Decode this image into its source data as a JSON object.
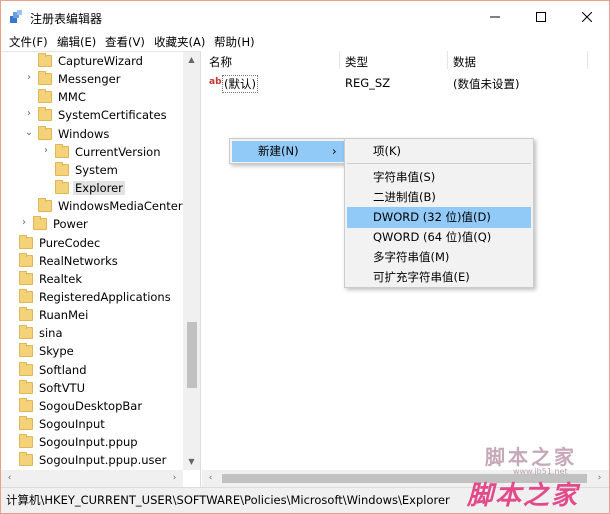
{
  "window": {
    "title": "注册表编辑器"
  },
  "menu": [
    "文件(F)",
    "编辑(E)",
    "查看(V)",
    "收藏夹(A)",
    "帮助(H)"
  ],
  "tree": {
    "items": [
      {
        "label": "CaptureWizard",
        "depth": 2,
        "chevron": ""
      },
      {
        "label": "Messenger",
        "depth": 2,
        "chevron": "›"
      },
      {
        "label": "MMC",
        "depth": 2,
        "chevron": ""
      },
      {
        "label": "SystemCertificates",
        "depth": 2,
        "chevron": "›"
      },
      {
        "label": "Windows",
        "depth": 2,
        "chevron": "⌄"
      },
      {
        "label": "CurrentVersion",
        "depth": 3,
        "chevron": "›"
      },
      {
        "label": "System",
        "depth": 3,
        "chevron": ""
      },
      {
        "label": "Explorer",
        "depth": 3,
        "chevron": "",
        "selected": true
      },
      {
        "label": "WindowsMediaCenter",
        "depth": 2,
        "chevron": ""
      },
      {
        "label": "Power",
        "depth": 1,
        "chevron": "›"
      },
      {
        "label": "PureCodec",
        "depth": 0,
        "chevron": ""
      },
      {
        "label": "RealNetworks",
        "depth": 0,
        "chevron": ""
      },
      {
        "label": "Realtek",
        "depth": 0,
        "chevron": ""
      },
      {
        "label": "RegisteredApplications",
        "depth": 0,
        "chevron": ""
      },
      {
        "label": "RuanMei",
        "depth": 0,
        "chevron": ""
      },
      {
        "label": "sina",
        "depth": 0,
        "chevron": ""
      },
      {
        "label": "Skype",
        "depth": 0,
        "chevron": ""
      },
      {
        "label": "Softland",
        "depth": 0,
        "chevron": ""
      },
      {
        "label": "SoftVTU",
        "depth": 0,
        "chevron": ""
      },
      {
        "label": "SogouDesktopBar",
        "depth": 0,
        "chevron": ""
      },
      {
        "label": "SogouInput",
        "depth": 0,
        "chevron": ""
      },
      {
        "label": "SogouInput.ppup",
        "depth": 0,
        "chevron": ""
      },
      {
        "label": "SogouInput.ppup.user",
        "depth": 0,
        "chevron": ""
      }
    ]
  },
  "list": {
    "columns": [
      "名称",
      "类型",
      "数据"
    ],
    "rows": [
      {
        "name": "(默认)",
        "type": "REG_SZ",
        "data": "(数值未设置)"
      }
    ]
  },
  "context_menu": {
    "parent_item": "新建(N)",
    "parent_arrow": "›",
    "submenu": [
      {
        "label": "项(K)"
      },
      {
        "label": "字符串值(S)"
      },
      {
        "label": "二进制值(B)"
      },
      {
        "label": "DWORD (32 位)值(D)",
        "highlighted": true
      },
      {
        "label": "QWORD (64 位)值(Q)"
      },
      {
        "label": "多字符串值(M)"
      },
      {
        "label": "可扩充字符串值(E)"
      }
    ]
  },
  "statusbar": {
    "path": "计算机\\HKEY_CURRENT_USER\\SOFTWARE\\Policies\\Microsoft\\Windows\\Explorer"
  },
  "watermark": {
    "top": "脚本之家",
    "url": "www.jb51.net",
    "bottom": "脚本之家"
  },
  "icons": {
    "app": "regedit-icon",
    "value": "string-value-icon",
    "folder": "folder-icon"
  }
}
